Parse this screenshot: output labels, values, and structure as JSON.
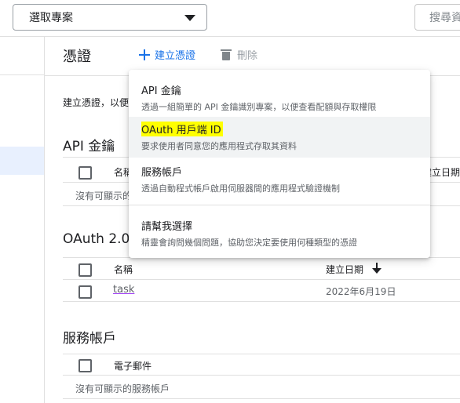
{
  "topbar": {
    "project_select": "選取專案",
    "search_placeholder": "搜尋資"
  },
  "header": {
    "title": "憑證",
    "create_label": "建立憑證",
    "delete_label": "刪除"
  },
  "description": "建立憑證，以便",
  "sections": {
    "api_keys": {
      "title": "API 金鑰",
      "col_name": "名稱",
      "col_created": "建立日期",
      "empty": "沒有可顯示的"
    },
    "oauth": {
      "title": "OAuth 2.0",
      "col_name": "名稱",
      "col_created": "建立日期",
      "rows": [
        {
          "name": "task",
          "created": "2022年6月19日"
        }
      ]
    },
    "service_accounts": {
      "title": "服務帳戶",
      "col_email": "電子郵件",
      "empty": "沒有可顯示的服務帳戶"
    }
  },
  "menu": {
    "items": [
      {
        "title": "API 金鑰",
        "subtitle": "透過一組簡單的 API 金鑰識別專案，以便查看配額與存取權限"
      },
      {
        "title": "OAuth 用戶端 ID",
        "subtitle": "要求使用者同意您的應用程式存取其資料"
      },
      {
        "title": "服務帳戶",
        "subtitle": "透過自動程式帳戶啟用伺服器間的應用程式驗證機制"
      },
      {
        "title": "請幫我選擇",
        "subtitle": "精靈會詢問幾個問題，協助您決定要使用何種類型的憑證"
      }
    ]
  },
  "colors": {
    "accent": "#1a73e8",
    "highlight": "#ffff00"
  }
}
